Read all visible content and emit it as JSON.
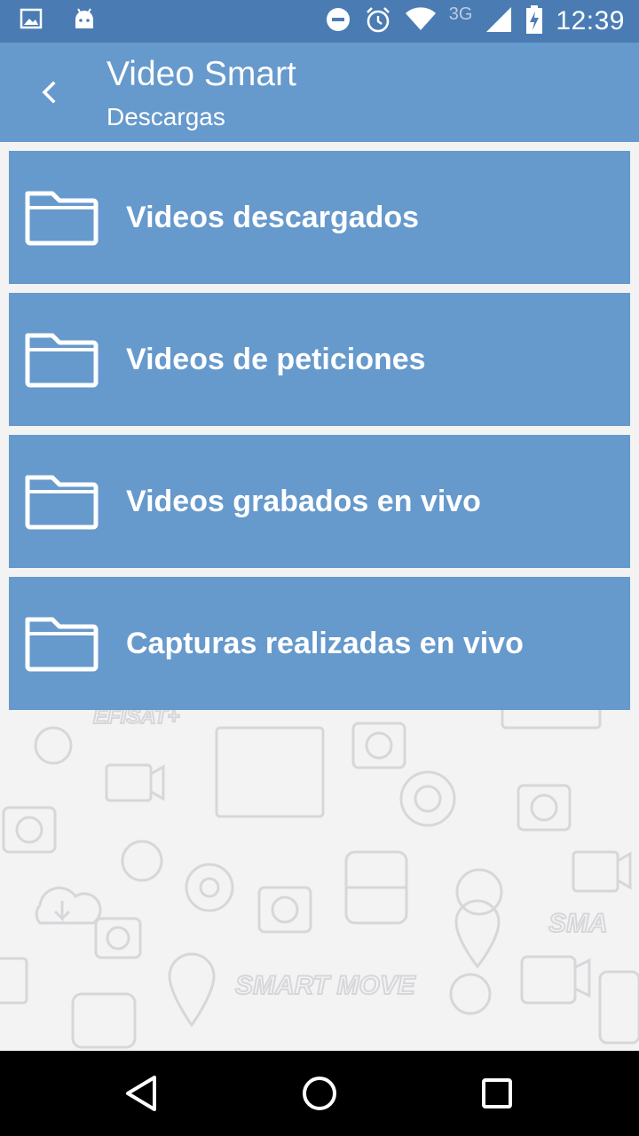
{
  "status_bar": {
    "network": "3G",
    "time": "12:39",
    "icons": [
      "image-icon",
      "android-icon",
      "do-not-disturb-icon",
      "alarm-icon",
      "wifi-icon",
      "signal-icon",
      "battery-charging-icon"
    ]
  },
  "app_bar": {
    "title": "Video Smart",
    "subtitle": "Descargas",
    "back_icon": "chevron-left-icon"
  },
  "folders": [
    {
      "label": "Videos descargados",
      "icon": "folder-icon"
    },
    {
      "label": "Videos de peticiones",
      "icon": "folder-icon"
    },
    {
      "label": "Videos grabados en vivo",
      "icon": "folder-icon"
    },
    {
      "label": "Capturas realizadas en vivo",
      "icon": "folder-icon"
    }
  ],
  "nav_bar": {
    "back": "triangle-back-icon",
    "home": "circle-home-icon",
    "recents": "square-recents-icon"
  },
  "colors": {
    "status_bar": "#4a7cb3",
    "app_bar": "#6699cc",
    "list_item": "#6699cc",
    "background": "#f3f3f4",
    "nav_bar": "#000000"
  }
}
